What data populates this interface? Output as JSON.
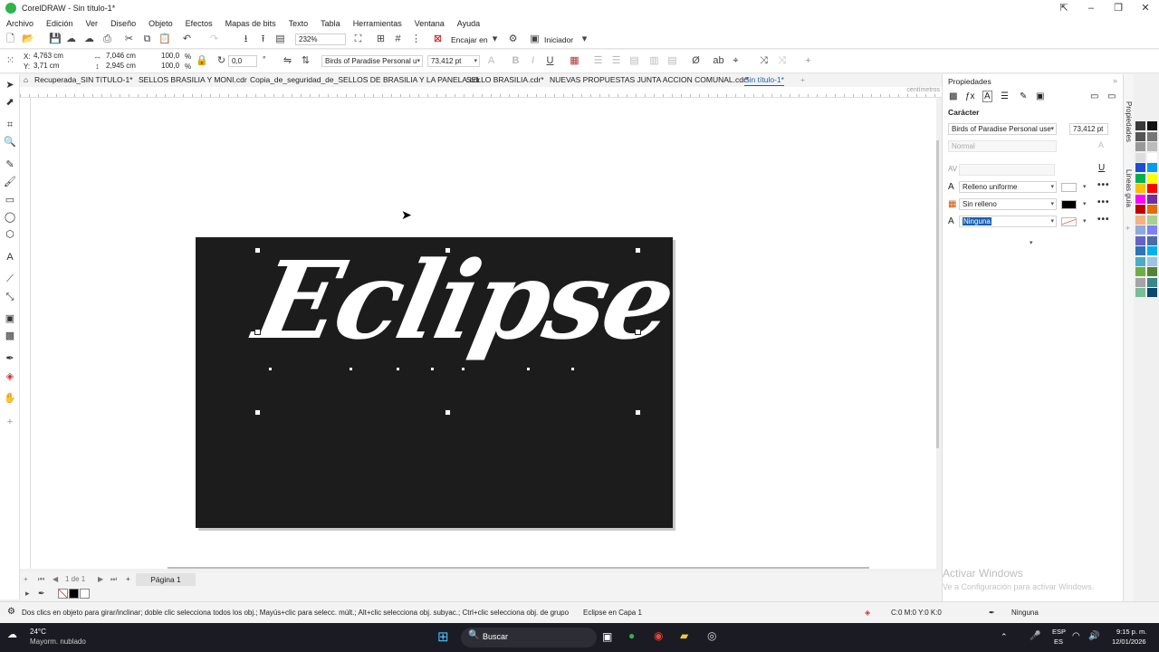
{
  "window": {
    "title": "CorelDRAW - Sin título-1*"
  },
  "menu": [
    "Archivo",
    "Edición",
    "Ver",
    "Diseño",
    "Objeto",
    "Efectos",
    "Mapas de bits",
    "Texto",
    "Tabla",
    "Herramientas",
    "Ventana",
    "Ayuda"
  ],
  "toolbar1": {
    "zoom": "232%",
    "snap_label": "Encajar en",
    "launch_label": "Iniciador"
  },
  "toolbar2": {
    "x": "4,763 cm",
    "y": "3,71 cm",
    "w": "7,046 cm",
    "h": "2,945 cm",
    "scale_x": "100,0",
    "scale_y": "100,0",
    "pct": "%",
    "angle": "0,0",
    "font": "Birds of Paradise  Personal u",
    "size": "73,412 pt"
  },
  "tabs": [
    "Recuperada_SIN TíTULO-1*",
    "SELLOS BRASILIA Y MONI.cdr",
    "Copia_de_seguridad_de_SELLOS DE BRASILIA Y LA PANELA.cdr",
    "SELLO BRASILIA.cdr*",
    "NUEVAS PROPUESTAS JUNTA ACCION COMUNAL.cdr*",
    "Sin título-1*"
  ],
  "ruler_unit": "centímetros",
  "canvas": {
    "artwork_text": "Eclipse"
  },
  "pagebar": {
    "page_count": "1 de 1",
    "page_tab": "Página 1"
  },
  "properties": {
    "title": "Propiedades",
    "section": "Carácter",
    "font": "Birds of Paradise  Personal use",
    "size": "73,412 pt",
    "style": "Normal",
    "fill": "Relleno uniforme",
    "background_fill": "Sin relleno",
    "outline": "Ninguna",
    "side_tab_1": "Propiedades",
    "side_tab_2": "Líneas guía",
    "fill_color": "#ffffff",
    "bg_color": "#000000"
  },
  "status": {
    "hint": "Dos clics en objeto para girar/inclinar; doble clic selecciona todos los obj.; Mayús+clic para selecc. múlt.; Alt+clic selecciona obj. subyac.; Ctrl+clic selecciona obj. de grupo",
    "object": "Eclipse en Capa 1",
    "color": "C:0 M:0 Y:0 K:0",
    "outline": "Ninguna"
  },
  "watermark": {
    "line1": "Activar Windows",
    "line2": "Ve a Configuración para activar Windows."
  },
  "taskbar": {
    "temp": "24°C",
    "weather": "Mayorm. nublado",
    "search": "Buscar",
    "lang1": "ESP",
    "lang2": "ES",
    "time": "9:15 p. m.",
    "date": "12/01/2026"
  },
  "palette": [
    "#3a3a3a",
    "#111111",
    "#555555",
    "#777777",
    "#999999",
    "#bbbbbb",
    "#dddddd",
    "#ffffff",
    "#1d4fd1",
    "#00a0e9",
    "#00b050",
    "#ffff00",
    "#ffc000",
    "#ff0000",
    "#ff00ff",
    "#7030a0",
    "#c00000",
    "#e46c0a",
    "#f4b183",
    "#a9d18e",
    "#8faadc",
    "#7f7fff",
    "#6464c8",
    "#4a6fa5",
    "#2e75b6",
    "#00b0f0",
    "#4bacc6",
    "#9dc3e6",
    "#70ad47",
    "#548235",
    "#a5a5a5",
    "#3b8686",
    "#79bd9a",
    "#0b486b"
  ]
}
